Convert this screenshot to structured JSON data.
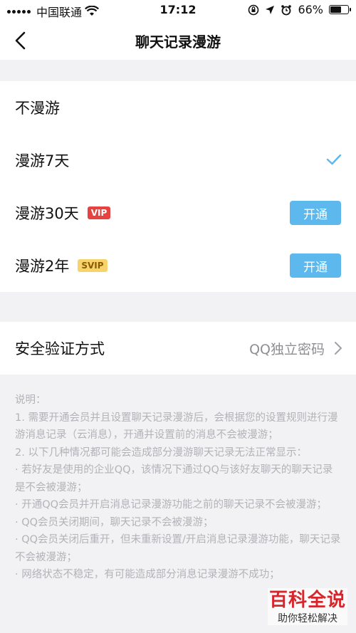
{
  "status": {
    "carrier": "中国联通",
    "time": "17:12",
    "battery_text": "66%",
    "battery_level": 0.66
  },
  "nav": {
    "title": "聊天记录漫游"
  },
  "options": [
    {
      "label": "不漫游",
      "badge": "",
      "selected": false,
      "button": ""
    },
    {
      "label": "漫游7天",
      "badge": "",
      "selected": true,
      "button": ""
    },
    {
      "label": "漫游30天",
      "badge": "VIP",
      "selected": false,
      "button": "开通"
    },
    {
      "label": "漫游2年",
      "badge": "SVIP",
      "selected": false,
      "button": "开通"
    }
  ],
  "security": {
    "label": "安全验证方式",
    "value": "QQ独立密码"
  },
  "notes": [
    "说明：",
    "1. 需要开通会员并且设置聊天记录漫游后，会根据您的设置规则进行漫游消息记录（云消息），开通并设置前的消息不会被漫游；",
    "2. 以下几种情况都可能会造成部分漫游聊天记录无法正常显示：",
    "· 若好友是使用的企业QQ，该情况下通过QQ与该好友聊天的聊天记录是不会被漫游；",
    "· 开通QQ会员并开启消息记录漫游功能之前的聊天记录不会被漫游；",
    "· QQ会员关闭期间，聊天记录不会被漫游；",
    "· QQ会员关闭后重开，但未重新设置/开启消息记录漫游功能，聊天记录不会被漫游；",
    "· 网络状态不稳定，有可能造成部分消息记录漫游不成功；"
  ],
  "watermark": {
    "main": "百科全说",
    "sub": "助你轻松解决"
  },
  "colors": {
    "accent": "#5db8ee",
    "check": "#5db8ee",
    "vip": "#e64340",
    "svip": "#f7d46b"
  },
  "icons": {
    "back": "chevron-left-icon",
    "check": "checkmark-icon",
    "chevron": "chevron-right-icon"
  }
}
